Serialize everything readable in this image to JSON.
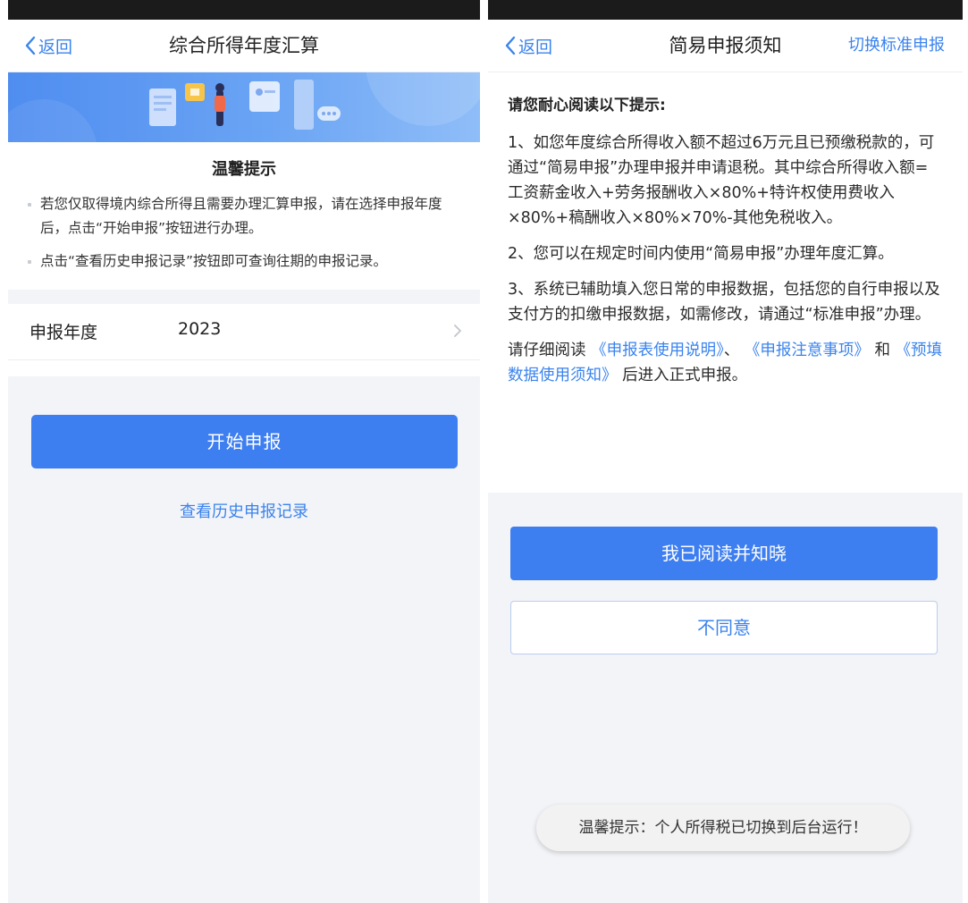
{
  "left": {
    "nav": {
      "back_label": "返回",
      "title": "综合所得年度汇算"
    },
    "tips": {
      "title": "温馨提示",
      "items": [
        "若您仅取得境内综合所得且需要办理汇算申报，请在选择申报年度后，点击“开始申报”按钮进行办理。",
        "点击“查看历史申报记录”按钮即可查询往期的申报记录。"
      ]
    },
    "year_row": {
      "label": "申报年度",
      "value": "2023"
    },
    "start_button": "开始申报",
    "history_link": "查看历史申报记录"
  },
  "right": {
    "nav": {
      "back_label": "返回",
      "title": "简易申报须知",
      "switch_label": "切换标准申报"
    },
    "heading": "请您耐心阅读以下提示:",
    "paragraphs": [
      "1、如您年度综合所得收入额不超过6万元且已预缴税款的，可通过“简易申报”办理申报并申请退税。其中综合所得收入额=工资薪金收入+劳务报酬收入×80%+特许权使用费收入×80%+稿酬收入×80%×70%-其他免税收入。",
      "2、您可以在规定时间内使用“简易申报”办理年度汇算。",
      "3、系统已辅助填入您日常的申报数据，包括您的自行申报以及支付方的扣缴申报数据，如需修改，请通过“标准申报”办理。"
    ],
    "reading": {
      "prefix": "请仔细阅读",
      "link1": "《申报表使用说明》",
      "sep1": "、",
      "link2": "《申报注意事项》",
      "sep2": "和",
      "link3": "《预填数据使用须知》",
      "suffix": "后进入正式申报。"
    },
    "agree_button": "我已阅读并知晓",
    "disagree_button": "不同意",
    "toast": "温馨提示：个人所得税已切换到后台运行！"
  },
  "colors": {
    "accent": "#3d7ef0",
    "link": "#3a83ee",
    "page_bg": "#f3f4f7"
  }
}
